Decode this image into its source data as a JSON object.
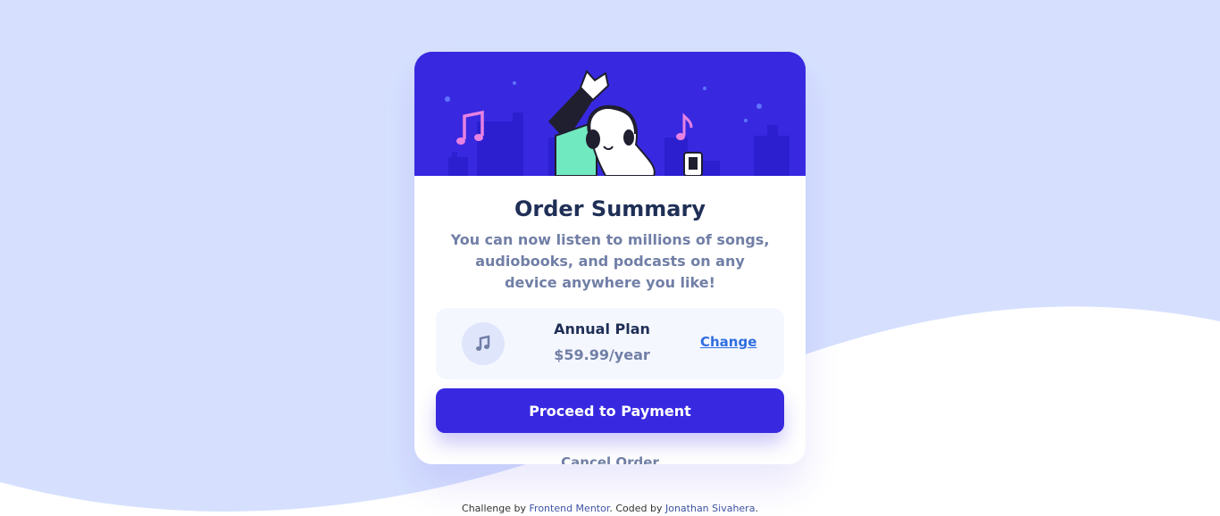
{
  "colors": {
    "page_background": "#d6e0fe",
    "wave": "#ffffff",
    "hero_background": "#3829e0",
    "primary_button": "#3829e0",
    "title_text": "#1f2f56",
    "muted_text": "#717fa6",
    "plan_box": "#f5f7ff",
    "link": "#2f6ee0",
    "skin_green": "#71e9c0",
    "music_note": "#e782e2"
  },
  "hero": {
    "illustration_icons": [
      "music-note-icon",
      "headphones-person-illustration",
      "city-skyline-illustration"
    ]
  },
  "card": {
    "title": "Order Summary",
    "description": "You can now listen to millions of songs, audiobooks, and podcasts on any device anywhere you like!",
    "plan": {
      "icon": "music-note-icon",
      "name": "Annual Plan",
      "price": "$59.99/year",
      "change_label": "Change"
    },
    "proceed_label": "Proceed to Payment",
    "cancel_label": "Cancel Order"
  },
  "attribution": {
    "prefix": "Challenge by ",
    "challenge_link": "Frontend Mentor",
    "middle": ". Coded by ",
    "author_link": "Jonathan Sivahera",
    "suffix": "."
  }
}
